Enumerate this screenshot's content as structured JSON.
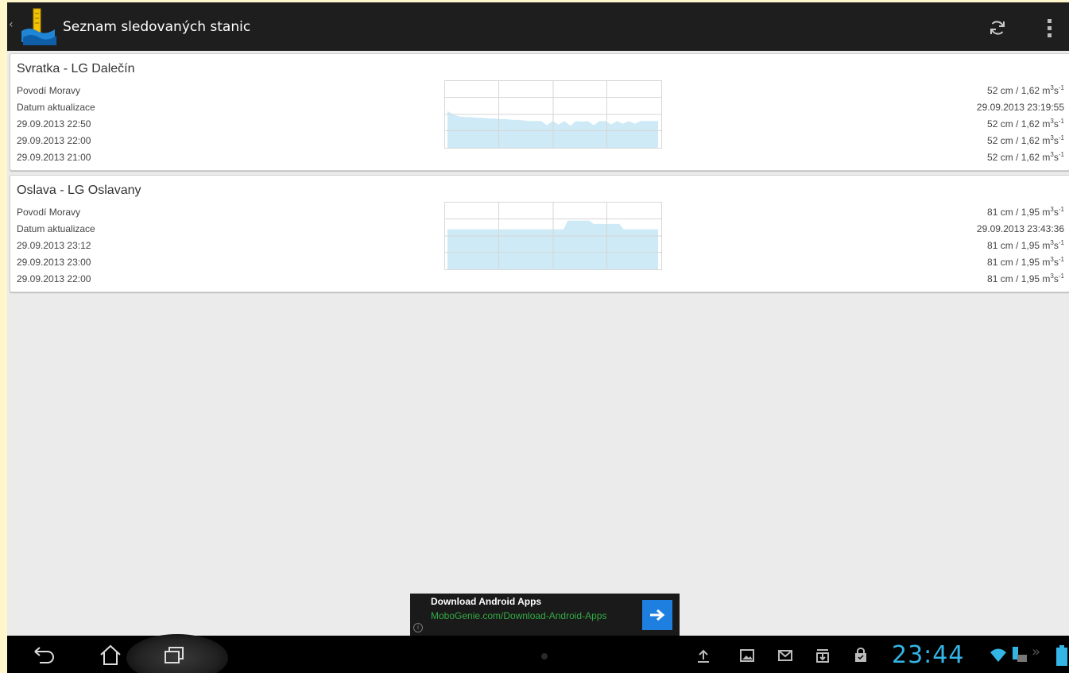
{
  "actionbar": {
    "title": "Seznam sledovaných stanic",
    "icons": [
      "app-logo-icon",
      "refresh-icon",
      "overflow-menu-icon"
    ]
  },
  "stations": [
    {
      "name": "Svratka - LG Dalečín",
      "basin": "Povodí Moravy",
      "current": {
        "value": "52 cm / 1,62 m",
        "exp1": "3",
        "unit": "s",
        "exp2": "-1"
      },
      "updated_label": "Datum aktualizace",
      "updated_value": "29.09.2013 23:19:55",
      "history": [
        {
          "time": "29.09.2013 22:50",
          "value": "52 cm / 1,62 m",
          "exp1": "3",
          "unit": "s",
          "exp2": "-1"
        },
        {
          "time": "29.09.2013 22:00",
          "value": "52 cm / 1,62 m",
          "exp1": "3",
          "unit": "s",
          "exp2": "-1"
        },
        {
          "time": "29.09.2013 21:00",
          "value": "52 cm / 1,62 m",
          "exp1": "3",
          "unit": "s",
          "exp2": "-1"
        }
      ],
      "sparkline": [
        0.55,
        0.5,
        0.47,
        0.46,
        0.46,
        0.45,
        0.45,
        0.44,
        0.44,
        0.43,
        0.43,
        0.42,
        0.42,
        0.41,
        0.4,
        0.4,
        0.4,
        0.34,
        0.4,
        0.35,
        0.4,
        0.33,
        0.4,
        0.39,
        0.4,
        0.34,
        0.4,
        0.4,
        0.35,
        0.4,
        0.36,
        0.4,
        0.36,
        0.4,
        0.4,
        0.4,
        0.4
      ]
    },
    {
      "name": "Oslava - LG Oslavany",
      "basin": "Povodí Moravy",
      "current": {
        "value": "81 cm / 1,95 m",
        "exp1": "3",
        "unit": "s",
        "exp2": "-1"
      },
      "updated_label": "Datum aktualizace",
      "updated_value": "29.09.2013 23:43:36",
      "history": [
        {
          "time": "29.09.2013 23:12",
          "value": "81 cm / 1,95 m",
          "exp1": "3",
          "unit": "s",
          "exp2": "-1"
        },
        {
          "time": "29.09.2013 23:00",
          "value": "81 cm / 1,95 m",
          "exp1": "3",
          "unit": "s",
          "exp2": "-1"
        },
        {
          "time": "29.09.2013 22:00",
          "value": "81 cm / 1,95 m",
          "exp1": "3",
          "unit": "s",
          "exp2": "-1"
        }
      ],
      "sparkline": [
        0.6,
        0.6,
        0.6,
        0.6,
        0.6,
        0.6,
        0.6,
        0.6,
        0.6,
        0.6,
        0.6,
        0.6,
        0.6,
        0.6,
        0.6,
        0.6,
        0.6,
        0.6,
        0.6,
        0.6,
        0.6,
        0.6,
        0.6,
        0.6,
        0.6,
        0.6,
        0.6,
        0.6,
        0.73,
        0.73,
        0.73,
        0.73,
        0.73,
        0.73,
        0.68,
        0.68,
        0.68,
        0.68,
        0.68,
        0.68,
        0.68,
        0.6,
        0.6,
        0.6,
        0.6,
        0.6,
        0.6,
        0.6,
        0.6,
        0.6
      ]
    }
  ],
  "ad": {
    "title": "Download Android Apps",
    "text": "MoboGenie.com/Download-Android-Apps",
    "info": "i"
  },
  "navbar": {
    "buttons": [
      "back-icon",
      "home-icon",
      "recent-apps-icon"
    ]
  },
  "statusbar": {
    "time": "23:44",
    "notifications": [
      "upload-icon",
      "gallery-icon",
      "gmail-icon",
      "download-icon",
      "shopping-bag-icon"
    ],
    "status_icons": [
      "wifi-icon",
      "keyboard-icon",
      "battery-icon"
    ]
  },
  "colors": {
    "chart_fill": "#cdeaf6",
    "clock": "#33b5e5",
    "ad_button": "#1e7fe0"
  }
}
